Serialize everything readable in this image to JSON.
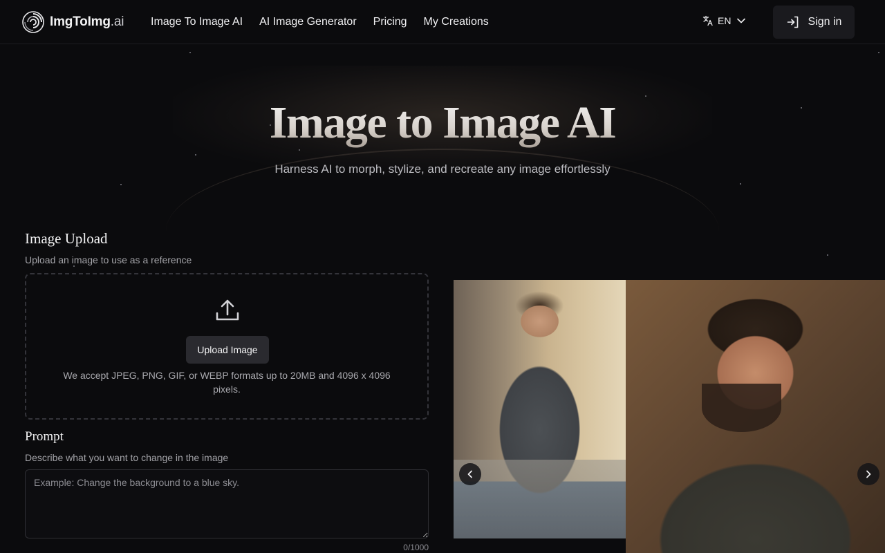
{
  "brand": {
    "name_main": "ImgToImg",
    "name_suffix": ".ai"
  },
  "nav": {
    "links": [
      "Image To Image AI",
      "AI Image Generator",
      "Pricing",
      "My Creations"
    ],
    "language": "EN",
    "sign_in": "Sign in"
  },
  "hero": {
    "title": "Image to Image AI",
    "subtitle": "Harness AI to morph, stylize, and recreate any image effortlessly"
  },
  "upload": {
    "title": "Image Upload",
    "description": "Upload an image to use as a reference",
    "button": "Upload Image",
    "note": "We accept JPEG, PNG, GIF, or WEBP formats up to 20MB and 4096 x 4096 pixels."
  },
  "prompt": {
    "title": "Prompt",
    "description": "Describe what you want to change in the image",
    "placeholder": "Example: Change the background to a blue sky.",
    "value": "",
    "counter": "0/1000"
  },
  "icons": {
    "logo": "spiral-logo-icon",
    "language": "translate-icon",
    "language_caret": "chevron-down-icon",
    "sign_in": "sign-in-icon",
    "upload": "upload-icon",
    "prev": "chevron-left-icon",
    "next": "chevron-right-icon"
  },
  "colors": {
    "background": "#0b0b0d",
    "button": "#2a2a2f",
    "text": "#e9e9ea"
  }
}
